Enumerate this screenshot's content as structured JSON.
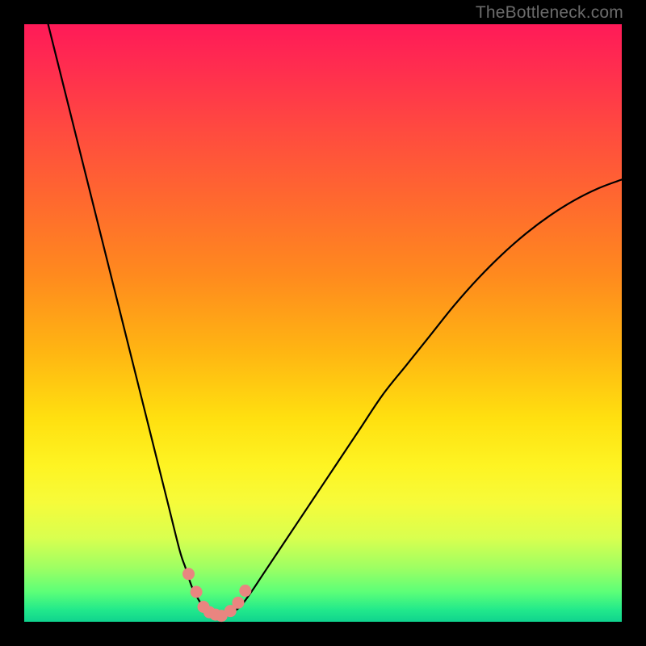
{
  "watermark": "TheBottleneck.com",
  "chart_data": {
    "type": "line",
    "title": "",
    "xlabel": "",
    "ylabel": "",
    "xlim": [
      0,
      100
    ],
    "ylim": [
      0,
      100
    ],
    "series": [
      {
        "name": "bottleneck-curve",
        "x": [
          4,
          6,
          8,
          10,
          12,
          14,
          16,
          18,
          20,
          22,
          24,
          26,
          27,
          28,
          29,
          30,
          31,
          32,
          33,
          34,
          36,
          38,
          40,
          44,
          48,
          52,
          56,
          60,
          64,
          68,
          72,
          76,
          80,
          84,
          88,
          92,
          96,
          100
        ],
        "values": [
          100,
          92,
          84,
          76,
          68,
          60,
          52,
          44,
          36,
          28,
          20,
          12,
          9,
          6,
          4,
          2.5,
          1.6,
          1.2,
          1.0,
          1.2,
          2.4,
          5,
          8,
          14,
          20,
          26,
          32,
          38,
          43,
          48,
          53,
          57.5,
          61.5,
          65,
          68,
          70.5,
          72.5,
          74
        ]
      }
    ],
    "markers": {
      "name": "highlight-dots",
      "color": "#e98580",
      "x": [
        27.5,
        28.8,
        30.0,
        31.0,
        32.0,
        33.0,
        34.5,
        35.8,
        37.0
      ],
      "values": [
        8.0,
        5.0,
        2.5,
        1.6,
        1.2,
        1.0,
        1.8,
        3.2,
        5.2
      ]
    },
    "gradient_stops": [
      {
        "pos": 0,
        "color": "#ff1a58"
      },
      {
        "pos": 18,
        "color": "#ff4b3f"
      },
      {
        "pos": 42,
        "color": "#ff8a1e"
      },
      {
        "pos": 66,
        "color": "#ffe010"
      },
      {
        "pos": 86,
        "color": "#d9ff4f"
      },
      {
        "pos": 100,
        "color": "#0fd38e"
      }
    ]
  }
}
